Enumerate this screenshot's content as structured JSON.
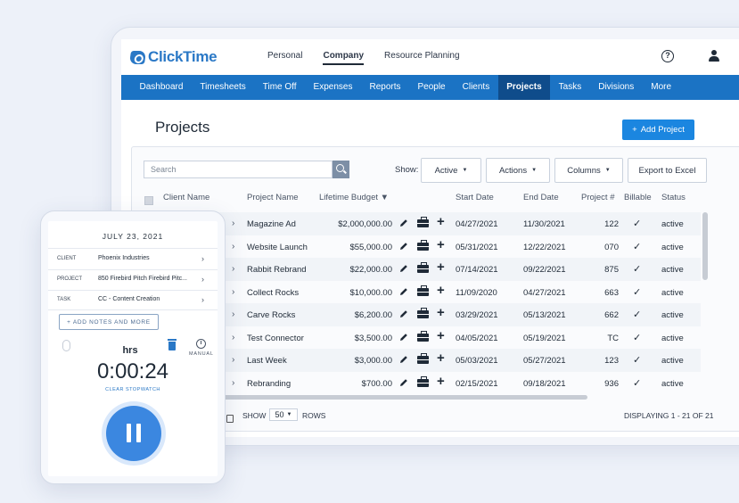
{
  "app": {
    "logo": "ClickTime"
  },
  "top_nav": [
    "Personal",
    "Company",
    "Resource Planning"
  ],
  "top_nav_active": "Company",
  "header_icons": {
    "help": "?",
    "help_icon": "question-circle-icon",
    "user_icon": "user-icon"
  },
  "main_nav": [
    "Dashboard",
    "Timesheets",
    "Time Off",
    "Expenses",
    "Reports",
    "People",
    "Clients",
    "Projects",
    "Tasks",
    "Divisions",
    "More"
  ],
  "main_nav_active": "Projects",
  "page": {
    "title": "Projects",
    "add_button": "Add Project",
    "add_icon": "+"
  },
  "toolbar": {
    "search_placeholder": "Search",
    "show_label": "Show:",
    "active_filter": "Active",
    "actions": "Actions",
    "columns": "Columns",
    "export": "Export to Excel"
  },
  "table": {
    "headers": [
      "Client Name",
      "Project Name",
      "Lifetime Budget ▼",
      "Start Date",
      "End Date",
      "Project #",
      "Billable",
      "Status"
    ],
    "rows": [
      {
        "name": "Magazine Ad",
        "budget": "$2,000,000.00",
        "start": "04/27/2021",
        "end": "11/30/2021",
        "num": "122",
        "billable": "✓",
        "status": "active"
      },
      {
        "name": "Website Launch",
        "budget": "$55,000.00",
        "start": "05/31/2021",
        "end": "12/22/2021",
        "num": "070",
        "billable": "✓",
        "status": "active"
      },
      {
        "name": "Rabbit Rebrand",
        "budget": "$22,000.00",
        "start": "07/14/2021",
        "end": "09/22/2021",
        "num": "875",
        "billable": "✓",
        "status": "active"
      },
      {
        "name": "Collect Rocks",
        "budget": "$10,000.00",
        "start": "11/09/2020",
        "end": "04/27/2021",
        "num": "663",
        "billable": "✓",
        "status": "active"
      },
      {
        "name": "Carve Rocks",
        "budget": "$6,200.00",
        "start": "03/29/2021",
        "end": "05/13/2021",
        "num": "662",
        "billable": "✓",
        "status": "active"
      },
      {
        "name": "Test Connector",
        "budget": "$3,500.00",
        "start": "04/05/2021",
        "end": "05/19/2021",
        "num": "TC",
        "billable": "✓",
        "status": "active"
      },
      {
        "name": "Last Week",
        "budget": "$3,000.00",
        "start": "05/03/2021",
        "end": "05/27/2021",
        "num": "123",
        "billable": "✓",
        "status": "active"
      },
      {
        "name": "Rebranding",
        "budget": "$700.00",
        "start": "02/15/2021",
        "end": "09/18/2021",
        "num": "936",
        "billable": "✓",
        "status": "active"
      }
    ],
    "row_chevron": "›",
    "row_plus": "+"
  },
  "footer": {
    "show": "SHOW",
    "rows_value": "50",
    "rows": "ROWS",
    "displaying": "DISPLAYING 1 - 21 OF 21"
  },
  "phone": {
    "date": "JULY 23, 2021",
    "fields": [
      {
        "key": "CLIENT",
        "value": "Phoenix Industries"
      },
      {
        "key": "PROJECT",
        "value": "850 Firebird Pitch Firebird Pitc..."
      },
      {
        "key": "TASK",
        "value": "CC - Content Creation"
      }
    ],
    "field_arrow": "›",
    "notes_button": "+ ADD NOTES AND MORE",
    "hrs": "hrs",
    "timer": "0:00:24",
    "manual": "MANUAL",
    "clear": "CLEAR STOPWATCH"
  },
  "colors": {
    "brand": "#1b73c4",
    "nav_active": "#0f4c8b",
    "button": "#1b86e0",
    "pause": "#3b87e0"
  }
}
